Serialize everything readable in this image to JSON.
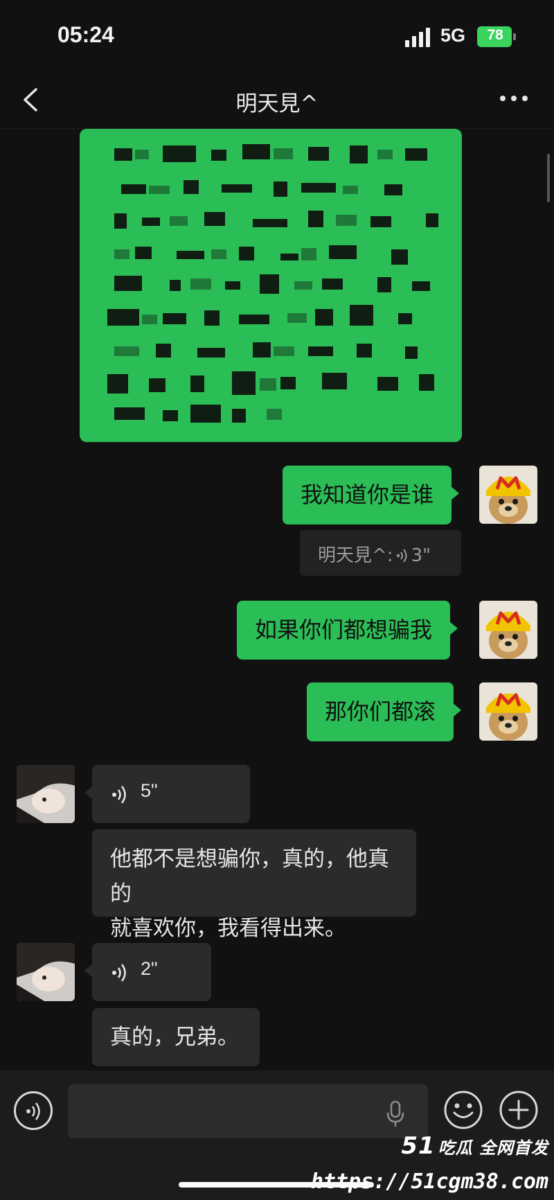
{
  "status_bar": {
    "time": "05:24",
    "network": "5G",
    "battery": "78"
  },
  "nav": {
    "title": "明天見^"
  },
  "messages": [
    {
      "id": "m1",
      "direction": "outgoing",
      "type": "text",
      "text": "我知道你是谁"
    },
    {
      "id": "m1t",
      "type": "transcript",
      "sender": "明天見^",
      "separator": ":",
      "duration": "3\""
    },
    {
      "id": "m2",
      "direction": "outgoing",
      "type": "text",
      "text": "如果你们都想骗我"
    },
    {
      "id": "m3",
      "direction": "outgoing",
      "type": "text",
      "text": "那你们都滚"
    },
    {
      "id": "m4",
      "direction": "incoming",
      "type": "voice",
      "duration": "5\""
    },
    {
      "id": "m5",
      "direction": "incoming",
      "type": "text",
      "lines": [
        "他都不是想骗你，真的，他真的",
        "就喜欢你，我看得出来。"
      ]
    },
    {
      "id": "m6",
      "direction": "incoming",
      "type": "voice",
      "duration": "2\""
    },
    {
      "id": "m7",
      "direction": "incoming",
      "type": "text",
      "text": "真的，兄弟。"
    }
  ],
  "input": {
    "placeholder": ""
  },
  "watermark": {
    "brand": "51",
    "tagline": "吃瓜 全网首发",
    "url": "https://51cgm38.com"
  },
  "colors": {
    "bubble_out": "#2bbe56",
    "bubble_in": "#2b2b2b",
    "background": "#111111",
    "battery": "#3ad35d"
  },
  "icons": [
    "signal-icon",
    "back-icon",
    "more-icon",
    "voice-wave-icon",
    "voice-toggle-icon",
    "mic-icon",
    "emoji-icon",
    "plus-icon"
  ]
}
